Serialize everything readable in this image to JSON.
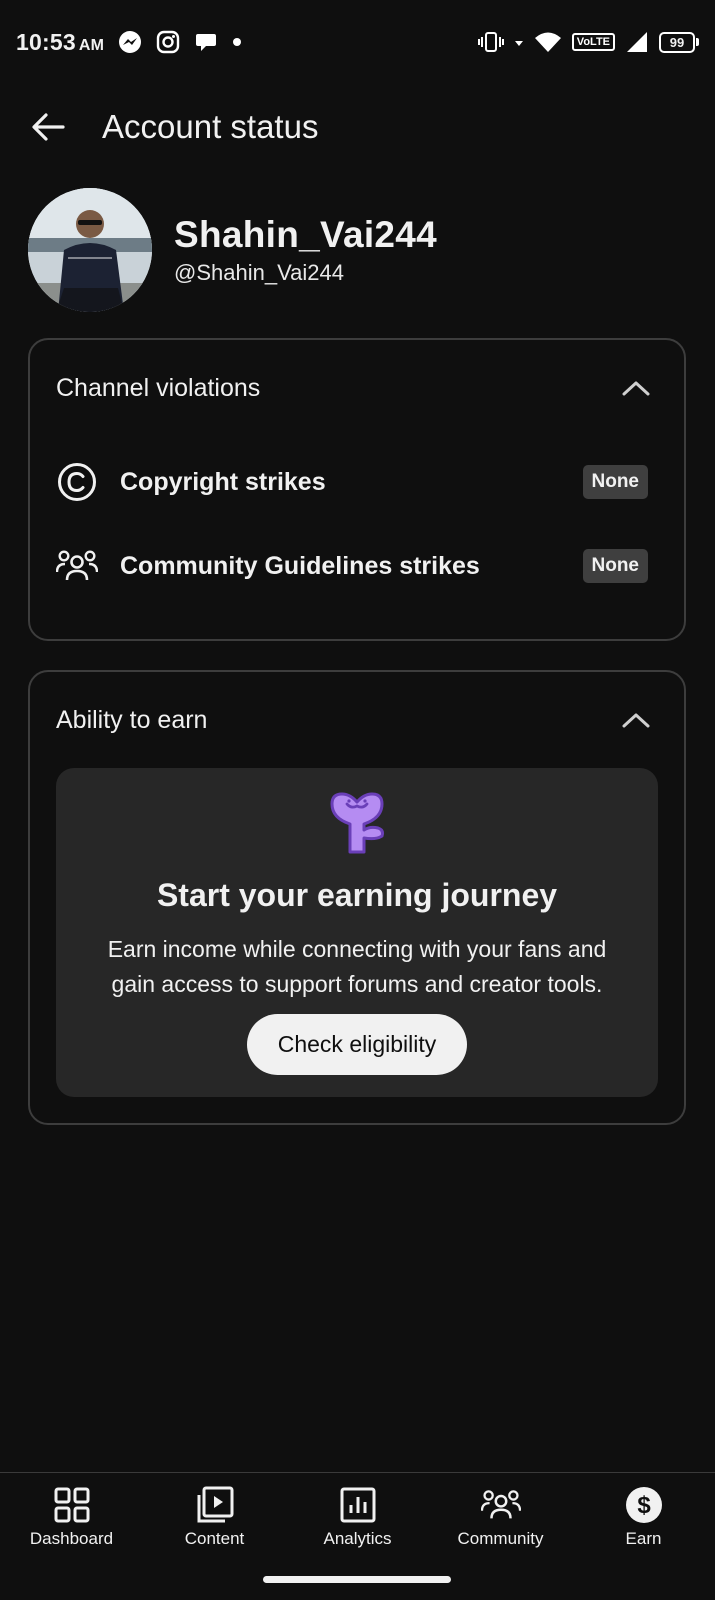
{
  "status_bar": {
    "time": "10:53",
    "ampm": "AM",
    "network_label": "VoLTE",
    "battery": "99"
  },
  "header": {
    "title": "Account status"
  },
  "profile": {
    "name": "Shahin_Vai244",
    "handle": "@Shahin_Vai244"
  },
  "violations": {
    "title": "Channel violations",
    "rows": [
      {
        "label": "Copyright strikes",
        "status": "None",
        "icon": "copyright-icon"
      },
      {
        "label": "Community Guidelines strikes",
        "status": "None",
        "icon": "community-icon"
      }
    ]
  },
  "earn_section": {
    "title": "Ability to earn",
    "heading": "Start your earning journey",
    "body": "Earn income while connecting with your fans and gain access to support forums and creator tools.",
    "button": "Check eligibility"
  },
  "bottom_nav": [
    {
      "label": "Dashboard",
      "icon": "dashboard-icon"
    },
    {
      "label": "Content",
      "icon": "content-icon"
    },
    {
      "label": "Analytics",
      "icon": "analytics-icon"
    },
    {
      "label": "Community",
      "icon": "community-icon"
    },
    {
      "label": "Earn",
      "icon": "earn-icon"
    }
  ],
  "colors": {
    "background": "#0f0f0f",
    "card_border": "#3d3d3d",
    "inner_card": "#272727",
    "accent_purple": "#9b6fe8"
  }
}
